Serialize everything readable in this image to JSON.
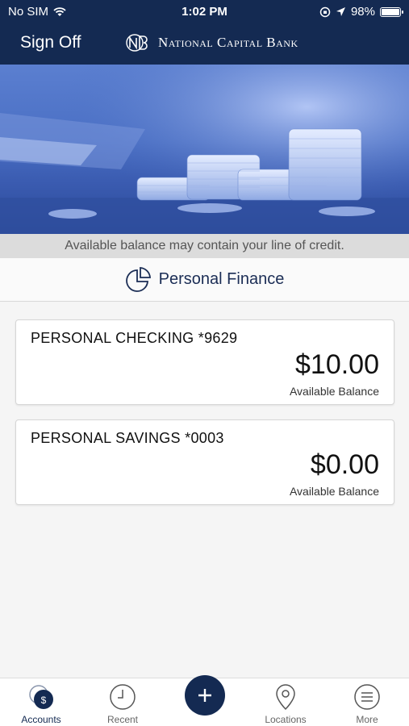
{
  "status_bar": {
    "carrier": "No SIM",
    "time": "1:02 PM",
    "battery": "98%",
    "battery_level": 0.98
  },
  "header": {
    "sign_off_label": "Sign Off",
    "bank_name": "National Capital Bank"
  },
  "notice": "Available balance may contain your line of credit.",
  "section": {
    "title": "Personal Finance"
  },
  "accounts": [
    {
      "name": "PERSONAL CHECKING *9629",
      "balance": "$10.00",
      "balance_label": "Available Balance"
    },
    {
      "name": "PERSONAL SAVINGS *0003",
      "balance": "$0.00",
      "balance_label": "Available Balance"
    }
  ],
  "tabs": {
    "accounts": "Accounts",
    "recent": "Recent",
    "locations": "Locations",
    "more": "More"
  },
  "colors": {
    "brand": "#142a52",
    "background": "#f5f5f5"
  }
}
